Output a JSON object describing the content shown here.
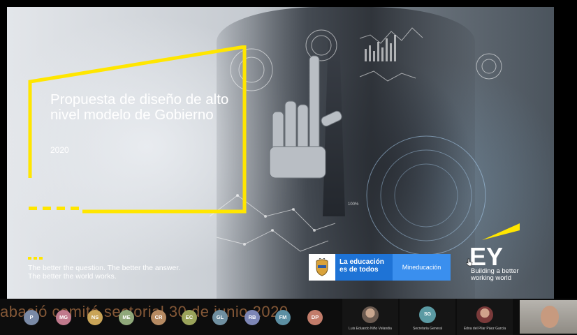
{
  "slide": {
    "title": "Propuesta de diseño de alto nivel modelo de Gobierno",
    "year": "2020",
    "tagline_line1": "The better the question. The better the answer.",
    "tagline_line2": "The better the world works.",
    "edu_line1": "La educación",
    "edu_line2": "es de todos",
    "mineducacion": "Mineducación",
    "ey_logo": "EY",
    "ey_line1": "Building a better",
    "ey_line2": "working world",
    "hud_label": "100%"
  },
  "strip": {
    "overlay_text": "abació comité sectorial 30 de junio 2020",
    "participants": [
      {
        "initials": "P",
        "color": "#7a8aa6"
      },
      {
        "initials": "MG",
        "color": "#c0798c"
      },
      {
        "initials": "NS",
        "color": "#c9a457"
      },
      {
        "initials": "ME",
        "color": "#8fa87a"
      },
      {
        "initials": "CR",
        "color": "#b58a62"
      },
      {
        "initials": "EC",
        "color": "#9aa35a"
      },
      {
        "initials": "GL",
        "color": "#6f8fa0"
      },
      {
        "initials": "RB",
        "color": "#7d86b6"
      },
      {
        "initials": "FM",
        "color": "#5c8fa3"
      },
      {
        "initials": "DP",
        "color": "#c27c6a"
      }
    ],
    "tiles": [
      {
        "name": "Luis Eduardo Niño Velandia",
        "initials": ""
      },
      {
        "name": "Secretaria General",
        "initials": "SG"
      },
      {
        "name": "Edna del Pilar Páez García",
        "initials": ""
      }
    ]
  }
}
